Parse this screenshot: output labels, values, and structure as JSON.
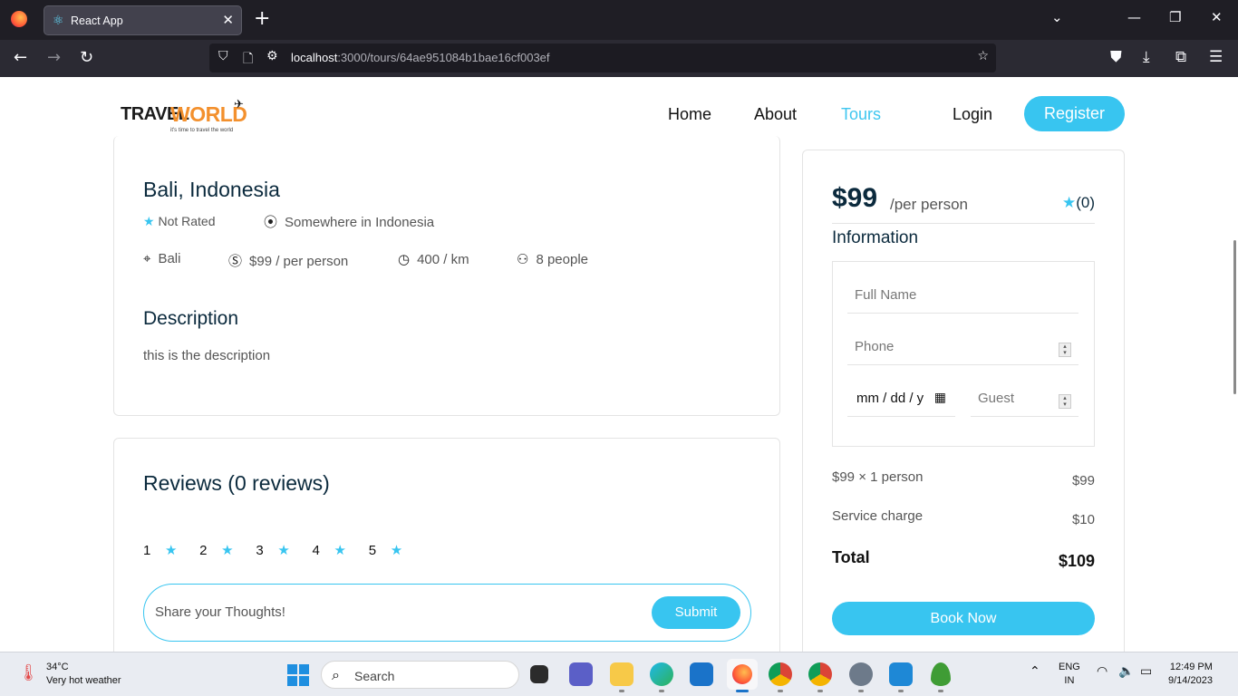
{
  "browser": {
    "tab_title": "React App",
    "url_host": "localhost",
    "url_rest": ":3000/tours/64ae951084b1bae16cf003ef"
  },
  "nav": {
    "logo_travel": "TRAVEL",
    "logo_world": "WORLD",
    "logo_tag": "it's time to travel the world",
    "items": [
      "Home",
      "About",
      "Tours"
    ],
    "login": "Login",
    "register": "Register"
  },
  "tour": {
    "title": "Bali, Indonesia",
    "rating": "Not Rated",
    "address": "Somewhere in Indonesia",
    "city": "Bali",
    "price_line": "$99 / per person",
    "distance": "400 / km",
    "group": "8 people",
    "desc_heading": "Description",
    "desc": "this is the description"
  },
  "reviews": {
    "heading": "Reviews (0 reviews)",
    "star_numbers": [
      "1",
      "2",
      "3",
      "4",
      "5"
    ],
    "placeholder": "Share your Thoughts!",
    "submit": "Submit"
  },
  "booking": {
    "price": "$99",
    "per": "/per person",
    "rating": "(0)",
    "info_heading": "Information",
    "full_name": "Full Name",
    "phone": "Phone",
    "date": "mm / dd / y",
    "guest": "Guest",
    "calc_label": "$99 × 1 person",
    "calc_value": "$99",
    "service_label": "Service charge",
    "service_value": "$10",
    "total_label": "Total",
    "total_value": "$109",
    "book": "Book Now"
  },
  "taskbar": {
    "temp": "34°C",
    "weather": "Very hot weather",
    "search": "Search",
    "lang1": "ENG",
    "lang2": "IN",
    "time": "12:49 PM",
    "date": "9/14/2023"
  }
}
